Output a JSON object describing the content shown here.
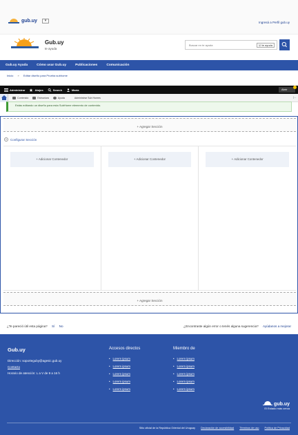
{
  "topbar": {
    "brand": "gub.uy",
    "login": "Ingresá a Perfil gub.uy"
  },
  "header": {
    "title": "Gub.uy",
    "subtitle": "te ayuda",
    "search_placeholder": "Buscar en te ayuda",
    "search_scope": "te ayuda"
  },
  "nav": [
    "Gub.uy Ayuda",
    "Cómo usar Gub.uy",
    "Publicaciones",
    "Comunicación"
  ],
  "breadcrumb": [
    "Inicio",
    "»",
    "Editar diseño para Prueba subhome"
  ],
  "admin_toolbar": {
    "items": [
      "Administrar",
      "Atajos",
      "Search",
      "María"
    ],
    "right": "Abrir"
  },
  "tray": {
    "items": [
      "Contenido",
      "Estructura",
      "Ayuda"
    ],
    "plain": "Administrar Sub Homes"
  },
  "message": "Estás editando un diseño para esta SubHome elemento de contenido.",
  "builder": {
    "add_section": "Agregar Sección",
    "configure": "Configurar Sección",
    "add_block": "Adicionar Contenedor"
  },
  "feedback": {
    "question": "¿Te pareció útil esta página?",
    "yes": "Sí",
    "no": "No",
    "error_q": "¿Encontraste algún error o tenés alguna sugerencia?",
    "help": "Ayúdanos a mejorar"
  },
  "footer": {
    "title": "Gub.uy",
    "email": "Dirección: soporteguby@agesic.gub.uy",
    "contact": "Contacto",
    "hours": "Horario de atención: L a V de 9 a 16 h",
    "col1_title": "Accesos directos",
    "col1_items": [
      "Lorem ipsum",
      "Lorem ipsum",
      "Lorem ipsum",
      "Lorem ipsum",
      "Lorem ipsum"
    ],
    "col2_title": "Miembro de",
    "col2_items": [
      "Lorem ipsum",
      "Lorem ipsum",
      "Lorem ipsum",
      "Lorem ipsum",
      "Lorem ipsum"
    ],
    "brand": "gub.uy",
    "brand_sub": "El Estado más cerca",
    "bottom": [
      "Sitio oficial de la República Oriental del Uruguay",
      "Declaración de accesibilidad",
      "Términos de uso",
      "Política de Privacidad"
    ]
  },
  "colors": {
    "primary": "#2d54a8",
    "sun": "#f6a01a",
    "success": "#3e9a35"
  }
}
